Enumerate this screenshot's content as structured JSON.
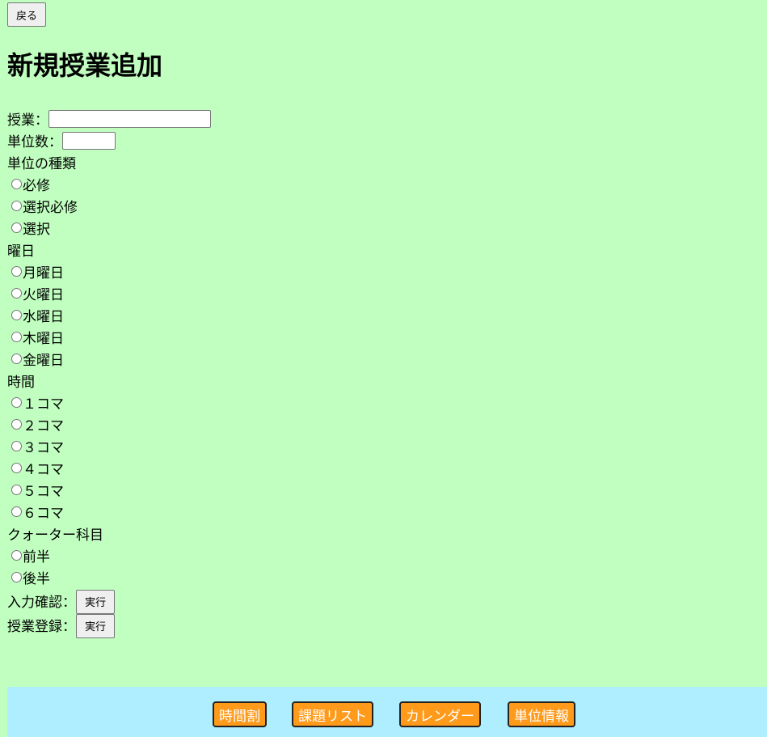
{
  "back_label": "戻る",
  "title": "新規授業追加",
  "form": {
    "class_label": "授業：",
    "class_value": "",
    "credits_label": "単位数：",
    "credits_value": "",
    "credit_type": {
      "label": "単位の種類",
      "options": [
        "必修",
        "選択必修",
        "選択"
      ]
    },
    "weekday": {
      "label": "曜日",
      "options": [
        "月曜日",
        "火曜日",
        "水曜日",
        "木曜日",
        "金曜日"
      ]
    },
    "period": {
      "label": "時間",
      "options": [
        "１コマ",
        "２コマ",
        "３コマ",
        "４コマ",
        "５コマ",
        "６コマ"
      ]
    },
    "quarter": {
      "label": "クォーター科目",
      "options": [
        "前半",
        "後半"
      ]
    },
    "confirm_label": "入力確認：",
    "confirm_button": "実行",
    "register_label": "授業登録：",
    "register_button": "実行"
  },
  "footer": {
    "items": [
      "時間割",
      "課題リスト",
      "カレンダー",
      "単位情報"
    ]
  },
  "colors": {
    "background": "#c0ffc0",
    "footer": "#aeeeff",
    "nav_button": "#ff9a1a"
  }
}
